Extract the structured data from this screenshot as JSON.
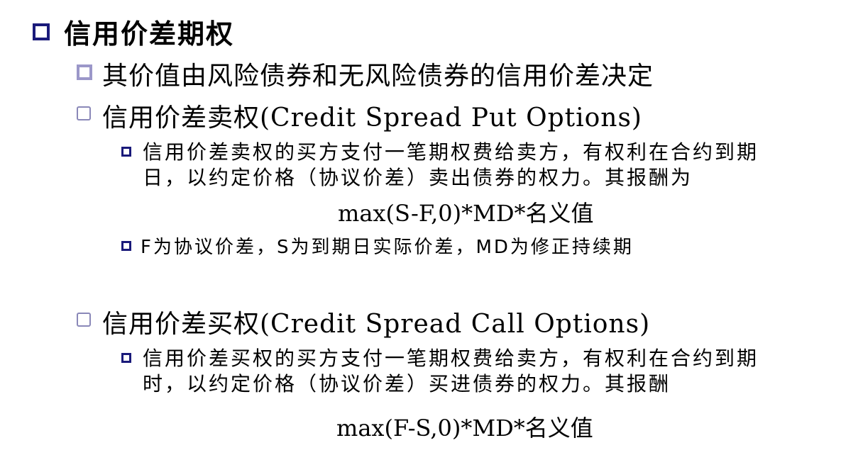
{
  "title": "信用价差期权",
  "items": [
    {
      "text": "其价值由风险债券和无风险债券的信用价差决定"
    },
    {
      "text": "信用价差卖权(Credit Spread Put Options)"
    },
    {
      "text": "信用价差买权(Credit Spread Call Options)"
    }
  ],
  "put": {
    "desc_line1": "信用价差卖权的买方支付一笔期权费给卖方，有权利在合约到期",
    "desc_line2": "日，以约定价格（协议价差）卖出债券的权力。其报酬为",
    "formula": "max(S-F,0)*MD*名义值",
    "note": "F为协议价差，S为到期日实际价差，MD为修正持续期"
  },
  "call": {
    "desc_line1": "信用价差买权的买方支付一笔期权费给卖方，有权利在合约到期",
    "desc_line2": "时，以约定价格（协议价差）买进债券的权力。其报酬",
    "formula": "max(F-S,0)*MD*名义值"
  }
}
